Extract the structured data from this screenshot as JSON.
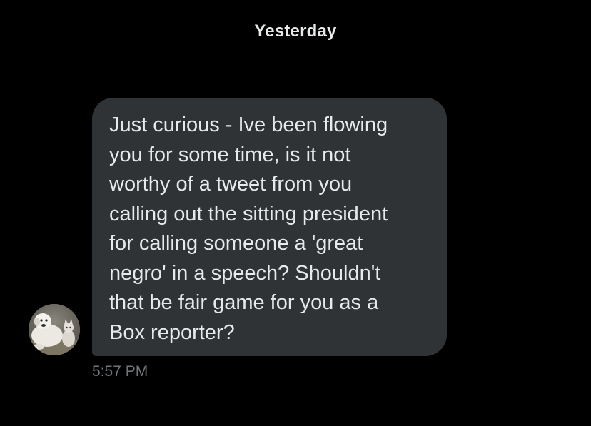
{
  "conversation": {
    "date_divider": "Yesterday",
    "messages": [
      {
        "sender_avatar": "avatar-photo-dog-and-cat",
        "text": "Just curious - Ive been flowing\nyou for some time, is it not\nworthy of a tweet from you\ncalling out the sitting president\nfor calling someone a 'great\nnegro' in a speech? Shouldn't\nthat be fair game for you as a\nBox reporter?",
        "time": "5:57 PM"
      }
    ]
  },
  "colors": {
    "background": "#000000",
    "bubble": "#2f3336",
    "text_primary": "#e7e9ea",
    "text_secondary": "#71767b"
  }
}
